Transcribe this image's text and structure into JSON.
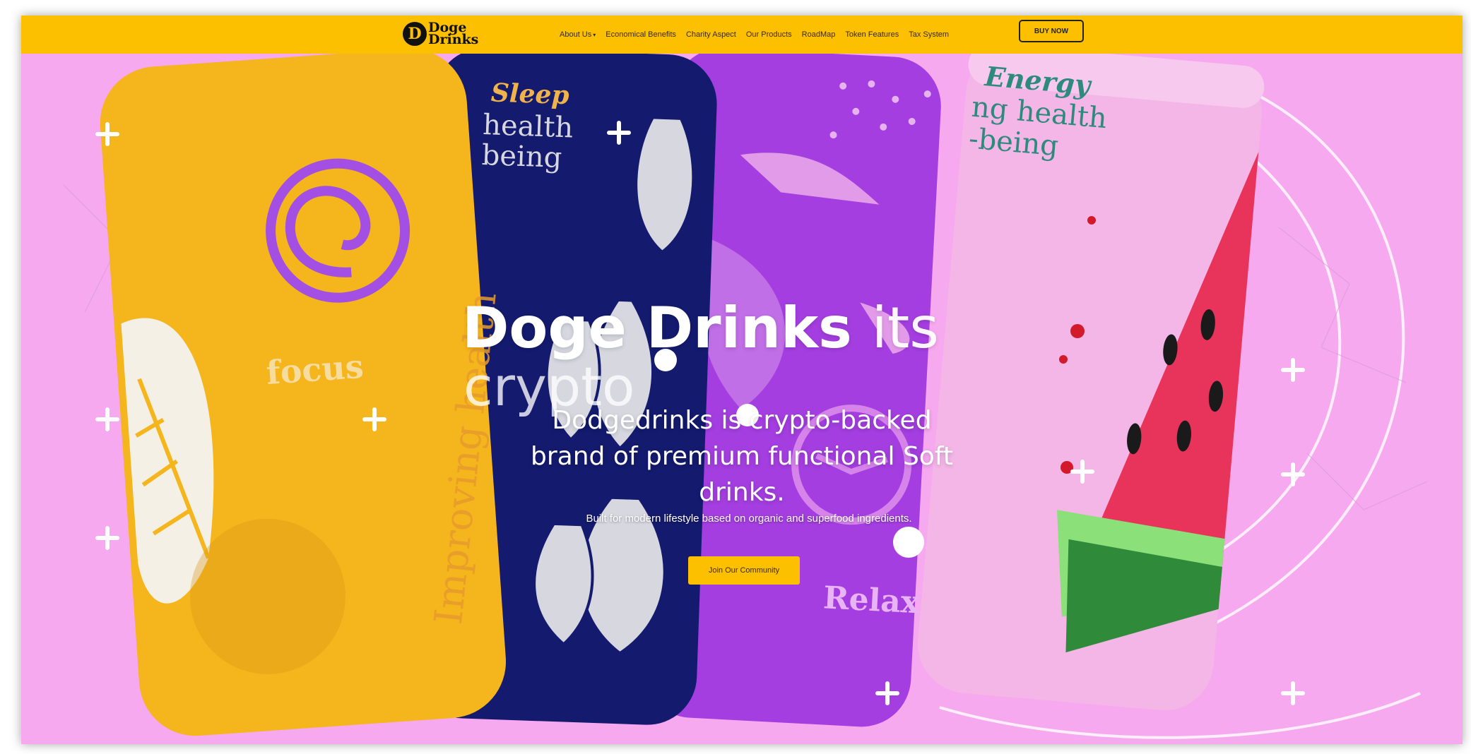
{
  "brand": {
    "logo_line1": "Doge",
    "logo_line2": "Drinks",
    "logo_glyph": "D"
  },
  "nav": {
    "items": [
      {
        "label": "About Us",
        "dropdown": true
      },
      {
        "label": "Economical Benefits"
      },
      {
        "label": "Charity Aspect"
      },
      {
        "label": "Our Products"
      },
      {
        "label": "RoadMap"
      },
      {
        "label": "Token Features"
      },
      {
        "label": "Tax System"
      }
    ],
    "buy_label": "BUY NOW"
  },
  "hero": {
    "title_bold": "Doge Drinks",
    "title_thin": "its",
    "title_line2": "crypto",
    "subtitle": "Dodgedrinks is crypto-backed brand of premium functional Soft drinks.",
    "description": "Built for modern lifestyle based on organic and superfood ingredients.",
    "cta_label": "Join Our Community"
  },
  "cans": {
    "can1": {
      "word": "focus",
      "side_text": "Improving health"
    },
    "can2": {
      "top1": "Sleep",
      "top2": "health",
      "top3": "being"
    },
    "can3": {
      "word": "Relax"
    },
    "can4": {
      "top1": "Energy",
      "top2": "ng health",
      "top3": "-being"
    }
  },
  "colors": {
    "nav_bg": "#fcc000",
    "hero_bg": "#f6a9ee",
    "can_yellow": "#f5b51c",
    "can_navy": "#141a6e",
    "can_purple": "#a43ee0",
    "can_pink": "#f3b6e6",
    "cta_bg": "#fcc000"
  }
}
